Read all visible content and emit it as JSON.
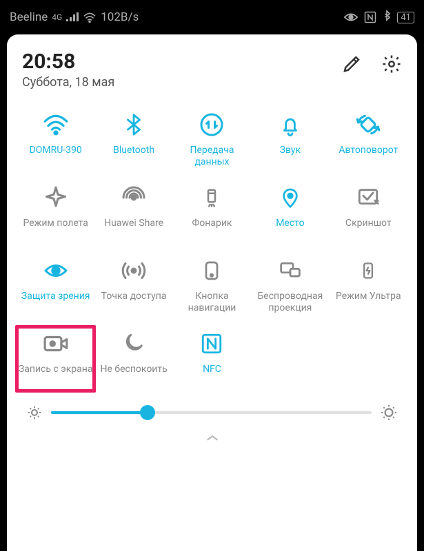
{
  "status_bar": {
    "carrier": "Beeline",
    "net_type": "4G",
    "speed": "102B/s",
    "battery": "41"
  },
  "header": {
    "time": "20:58",
    "date": "Суббота, 18 мая"
  },
  "tiles": [
    {
      "label": "DOMRU-390",
      "on": true,
      "icon": "wifi"
    },
    {
      "label": "Bluetooth",
      "on": true,
      "icon": "bluetooth"
    },
    {
      "label": "Передача данных",
      "on": true,
      "icon": "data"
    },
    {
      "label": "Звук",
      "on": true,
      "icon": "bell"
    },
    {
      "label": "Автоповорот",
      "on": true,
      "icon": "rotate"
    },
    {
      "label": "Режим полета",
      "on": false,
      "icon": "airplane"
    },
    {
      "label": "Huawei Share",
      "on": false,
      "icon": "share"
    },
    {
      "label": "Фонарик",
      "on": false,
      "icon": "flash"
    },
    {
      "label": "Место",
      "on": true,
      "icon": "location"
    },
    {
      "label": "Скриншот",
      "on": false,
      "icon": "screenshot"
    },
    {
      "label": "Защита зрения",
      "on": true,
      "icon": "eye"
    },
    {
      "label": "Точка доступа",
      "on": false,
      "icon": "hotspot"
    },
    {
      "label": "Кнопка навигации",
      "on": false,
      "icon": "navkey"
    },
    {
      "label": "Беспроводная проекция",
      "on": false,
      "icon": "cast"
    },
    {
      "label": "Режим Ультра",
      "on": false,
      "icon": "ultra"
    },
    {
      "label": "Запись с экрана",
      "on": false,
      "icon": "record",
      "highlight": true
    },
    {
      "label": "Не беспокоить",
      "on": false,
      "icon": "dnd"
    },
    {
      "label": "NFC",
      "on": true,
      "icon": "nfc"
    }
  ],
  "brightness": {
    "percent": 30
  }
}
